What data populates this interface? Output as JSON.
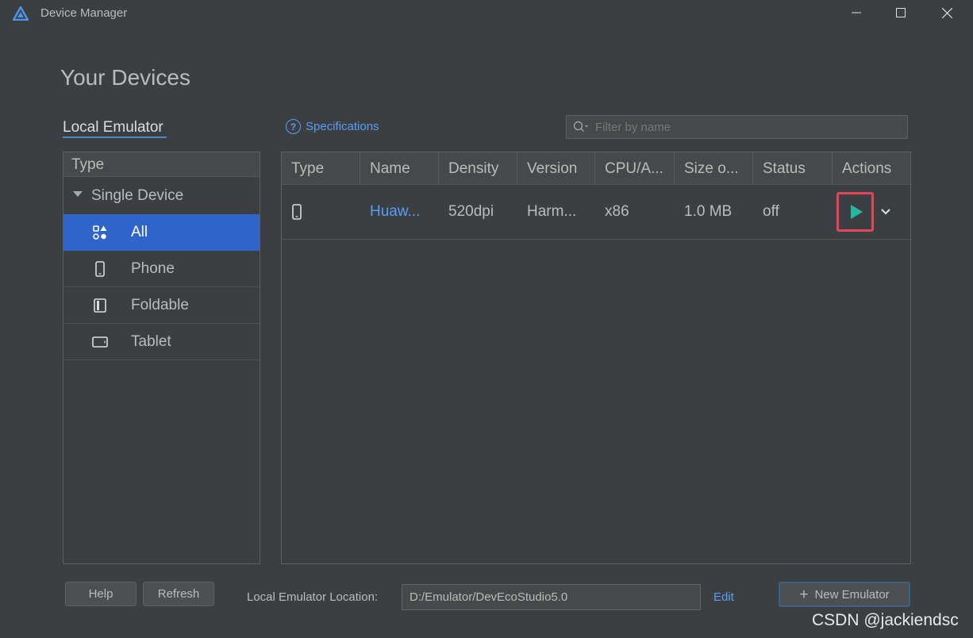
{
  "window": {
    "title": "Device Manager"
  },
  "page": {
    "title": "Your Devices",
    "tab_local": "Local Emulator",
    "specifications": "Specifications",
    "filter_placeholder": "Filter by name"
  },
  "sidebar": {
    "header": "Type",
    "group": "Single Device",
    "items": [
      {
        "label": "All",
        "icon": "category-grid-icon",
        "selected": true
      },
      {
        "label": "Phone",
        "icon": "phone-icon",
        "selected": false
      },
      {
        "label": "Foldable",
        "icon": "foldable-icon",
        "selected": false
      },
      {
        "label": "Tablet",
        "icon": "tablet-icon",
        "selected": false
      }
    ]
  },
  "table": {
    "columns": [
      "Type",
      "Name",
      "Density",
      "Version",
      "CPU/A...",
      "Size o...",
      "Status",
      "Actions"
    ],
    "rows": [
      {
        "type_icon": "phone-icon",
        "name": "Huaw...",
        "density": "520dpi",
        "version": "Harm...",
        "cpu": "x86",
        "size": "1.0 MB",
        "status": "off"
      }
    ]
  },
  "footer": {
    "help": "Help",
    "refresh": "Refresh",
    "location_label": "Local Emulator Location:",
    "location_value": "D:/Emulator/DevEcoStudio5.0",
    "edit": "Edit",
    "new_emulator": "New Emulator"
  },
  "watermark": "CSDN @jackiendsc",
  "colors": {
    "background": "#3c3f41",
    "accent": "#589df6",
    "selection": "#2f65ca",
    "run": "#25b7a2",
    "highlight": "#e5455c"
  }
}
